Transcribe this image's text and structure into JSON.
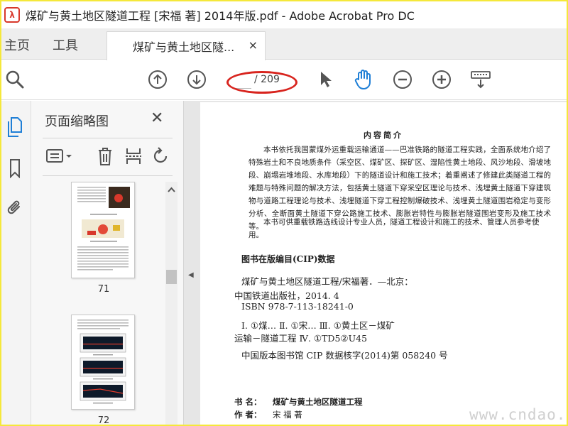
{
  "window": {
    "title": "煤矿与黄土地区隧道工程 [宋福 著] 2014年版.pdf - Adobe Acrobat Pro DC"
  },
  "tabs": {
    "home": "主页",
    "tools": "工具",
    "document": "煤矿与黄土地区隧...",
    "close": "×"
  },
  "toolbar": {
    "page_input": "",
    "page_total": "/ 209",
    "icons": [
      "search-icon",
      "page-up-icon",
      "page-down-icon",
      "select-arrow-icon",
      "hand-tool-icon",
      "zoom-out-icon",
      "zoom-in-icon",
      "keyboard-scroll-icon"
    ]
  },
  "colors": {
    "accent": "#1f7fd6",
    "annotation": "#d8241e",
    "frame": "#f5e83a"
  },
  "sidebar": {
    "title": "页面缩略图",
    "close": "✕",
    "thumbnails": [
      {
        "label": "71"
      },
      {
        "label": "72"
      }
    ]
  },
  "document": {
    "heading": "内容简介",
    "para1": "本书依托我国蒙煤外运重载运输通道——巴准铁路的隧道工程实践，全面系统地介绍了特殊岩土和不良地质条件（采空区、煤矿区、探矿区、湿陷性黄土地段、风沙地段、滑坡地段、崩塌岩堆地段、水库地段）下的隧道设计和施工技术；着重阐述了修建此类隧道工程的难题与特殊问题的解决方法，包括黄土隧道下穿采空区理论与技术、浅埋黄土隧道下穿建筑物与道路工程理论与技术、浅埋隧道下穿工程控制爆破技术、浅埋黄土隧道围岩稳定与变形分析、全断面黄土隧道下穿公路施工技术、膨胀岩特性与膨胀岩隧道围岩变形及施工技术等。",
    "para2": "本书可供重载铁路选线设计专业人员，隧道工程设计和施工的技术、管理人员参考使用。",
    "cip_title": "图书在版编目(CIP)数据",
    "cip_lines": [
      "煤矿与黄土地区隧道工程/宋福著．—北京：",
      "中国铁道出版社，2014. 4",
      "ISBN 978-7-113-18241-0",
      "Ⅰ. ①煤…  Ⅱ. ①宋…  Ⅲ. ①黄土区－煤矿",
      "运输－隧道工程  Ⅳ. ①TD5②U45",
      "中国版本图书馆 CIP 数据核字(2014)第 058240 号"
    ],
    "book_name_key": "书    名：",
    "book_name": "煤矿与黄土地区隧道工程",
    "author_key": "作    者：",
    "author": "宋  福  著"
  },
  "watermark": "www.cndao.com"
}
